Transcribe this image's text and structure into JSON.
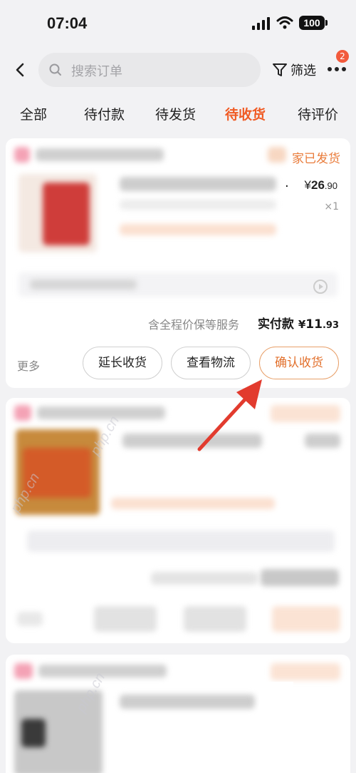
{
  "status_bar": {
    "time": "07:04",
    "battery": "100"
  },
  "header": {
    "search_placeholder": "搜索订单",
    "filter_label": "筛选",
    "badge_count": "2"
  },
  "tabs": [
    {
      "label": "全部"
    },
    {
      "label": "待付款"
    },
    {
      "label": "待发货"
    },
    {
      "label": "待收货"
    },
    {
      "label": "待评价"
    }
  ],
  "active_tab": "待收货",
  "order": {
    "shop_status": "家已发货",
    "dot": ".",
    "price_symbol": "¥",
    "price_int": "26",
    "price_dec": ".90",
    "quantity": "×1",
    "service_text": "含全程价保等服务",
    "paid_label": "实付款",
    "paid_symbol": "¥",
    "paid_int": "11",
    "paid_dec": ".93",
    "more_label": "更多",
    "extend_button": "延长收货",
    "logistics_button": "查看物流",
    "confirm_button": "确认收货"
  },
  "watermark": "php.cn",
  "colors": {
    "accent": "#f05a23",
    "confirm_border": "#e8a06a",
    "arrow": "#e23b2e",
    "badge": "#f25a3c"
  }
}
